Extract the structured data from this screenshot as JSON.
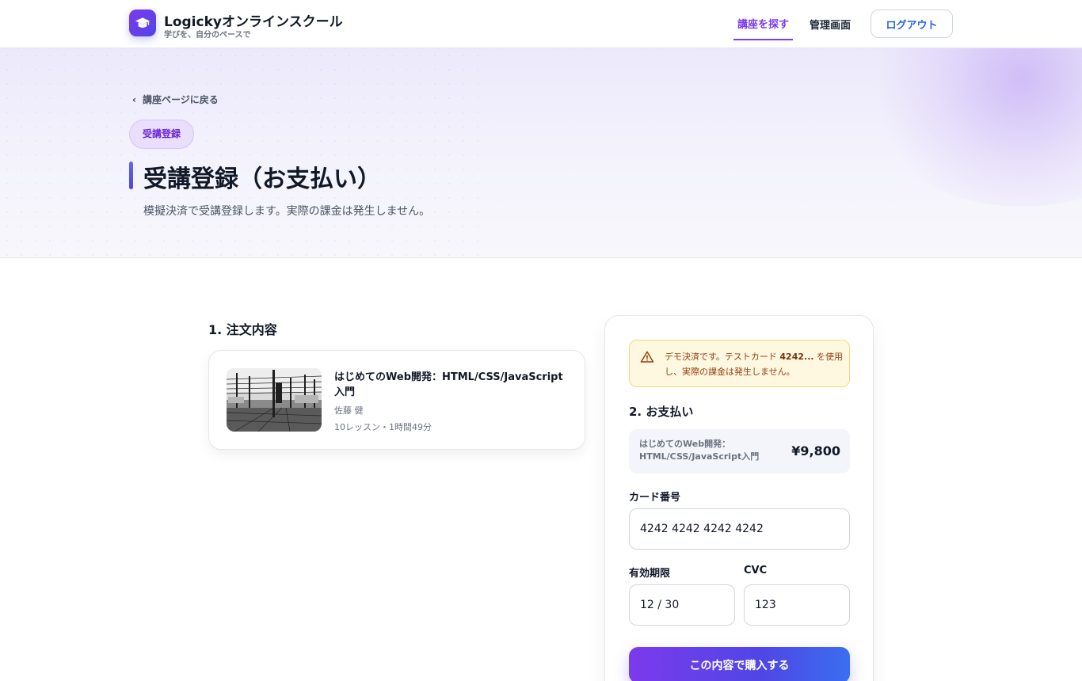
{
  "header": {
    "brand_name": "Logickyオンラインスクール",
    "brand_tagline": "学びを、自分のペースで",
    "nav_find": "講座を探す",
    "nav_admin": "管理画面",
    "logout": "ログアウト",
    "logo_icon": "graduation-cap-icon"
  },
  "hero": {
    "back_link": "講座ページに戻る",
    "badge": "受講登録",
    "title": "受講登録（お支払い）",
    "subtitle": "模擬決済で受講登録します。実際の課金は発生しません。"
  },
  "order": {
    "heading": "1. 注文内容",
    "course_title": "はじめてのWeb開発：HTML/CSS/JavaScript入門",
    "author": "佐藤 健",
    "meta": "10レッスン・1時間49分"
  },
  "payment": {
    "notice_prefix": "デモ決済です。テストカード ",
    "notice_card": "4242...",
    "notice_suffix": " を使用し、実際の課金は発生しません。",
    "heading": "2. お支払い",
    "summary_name": "はじめてのWeb開発：HTML/CSS/JavaScript入門",
    "summary_price": "¥9,800",
    "card_label": "カード番号",
    "card_value": "4242 4242 4242 4242",
    "expiry_label": "有効期限",
    "expiry_value": "12 / 30",
    "cvc_label": "CVC",
    "cvc_value": "123",
    "submit": "この内容で購入する"
  },
  "colors": {
    "accent": "#7c3aed",
    "link_blue": "#2563eb",
    "notice_bg": "#fff8e1",
    "notice_text": "#92400e"
  }
}
